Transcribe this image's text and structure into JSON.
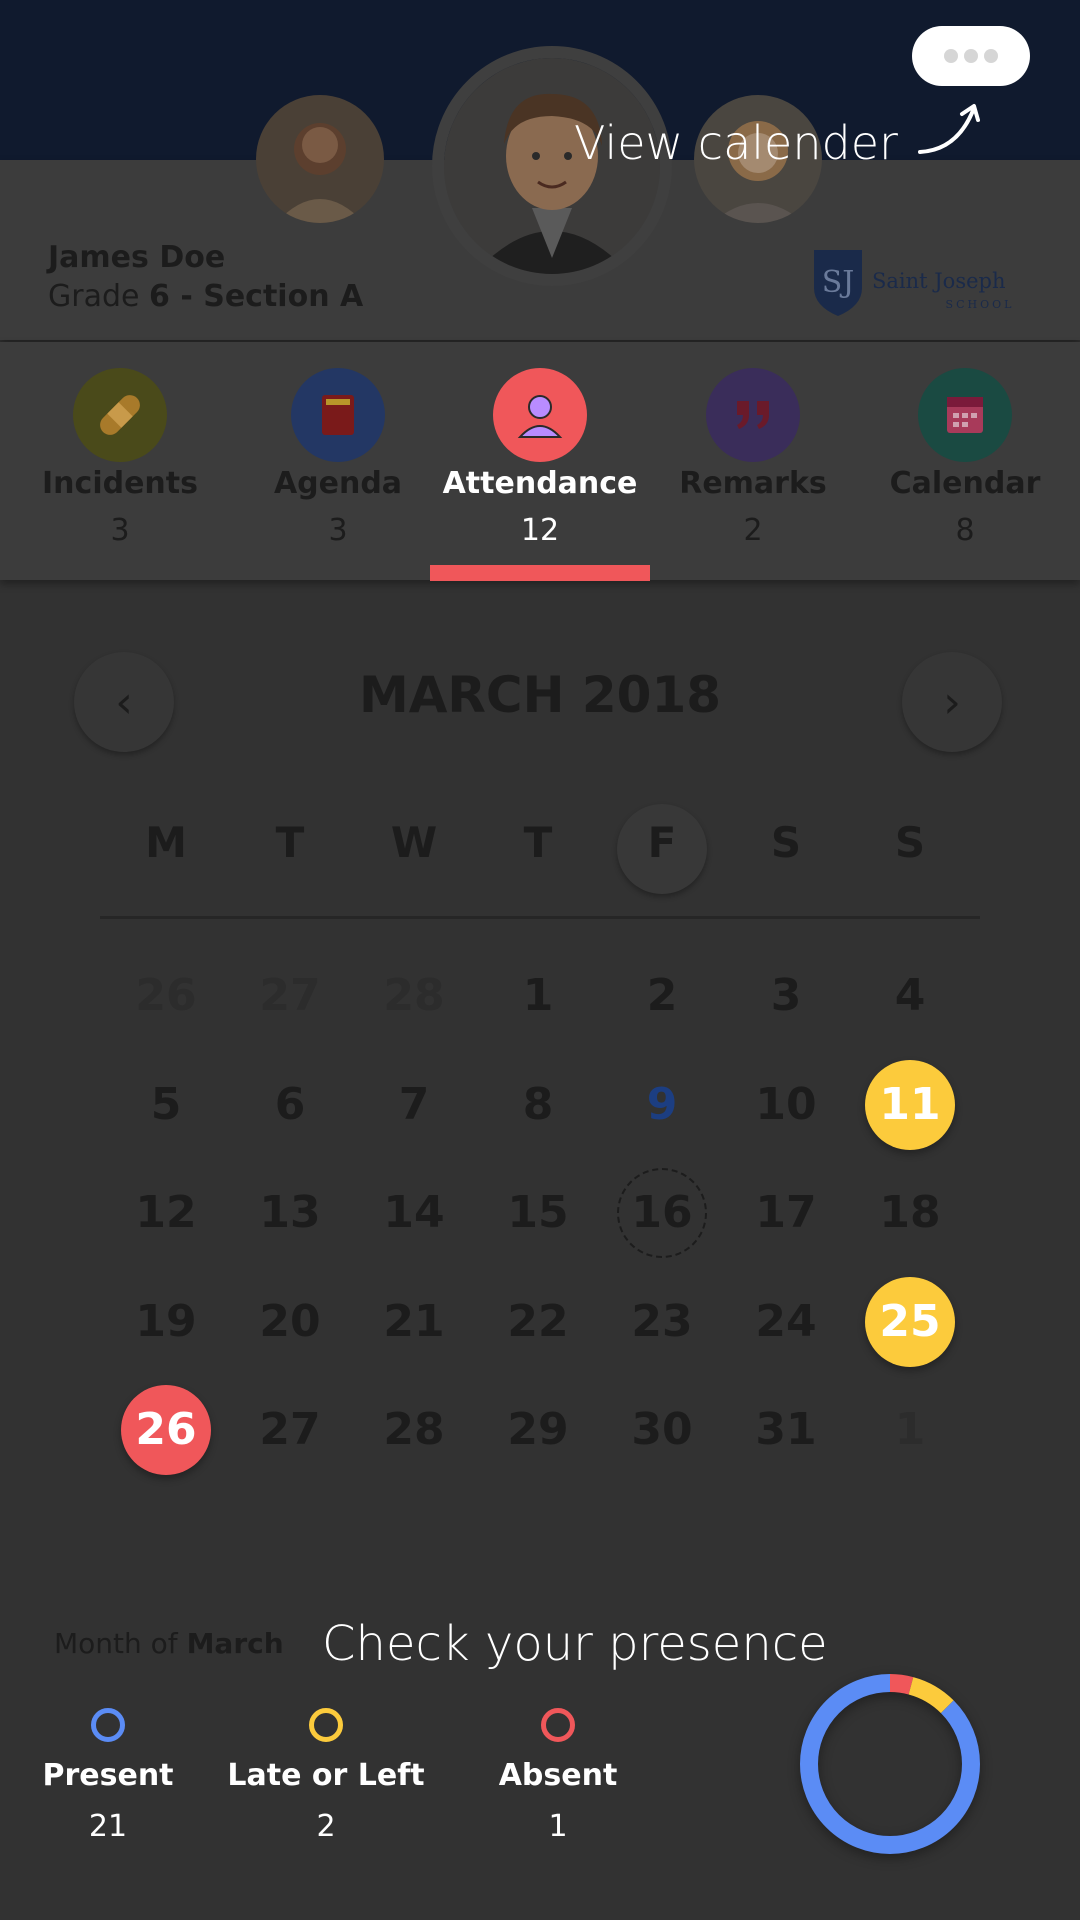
{
  "header": {
    "more_button": "more-options",
    "hint_view": "View calender"
  },
  "student": {
    "name": "James Doe",
    "grade_prefix": "Grade ",
    "grade": "6",
    "grade_sep": " - Section ",
    "section": "A"
  },
  "school": {
    "name_line1": "Saint Joseph",
    "name_line2": "SCHOOL",
    "monogram": "SJ"
  },
  "tabs": [
    {
      "label": "Incidents",
      "count": "3",
      "color": "#f1e60e",
      "icon": "bandage-icon"
    },
    {
      "label": "Agenda",
      "count": "3",
      "color": "#3a6bd9",
      "icon": "book-icon"
    },
    {
      "label": "Attendance",
      "count": "12",
      "color": "#f0575a",
      "icon": "person-icon"
    },
    {
      "label": "Remarks",
      "count": "2",
      "color": "#7e4cd8",
      "icon": "quote-icon"
    },
    {
      "label": "Calendar",
      "count": "8",
      "color": "#0f8a78",
      "icon": "calendar-icon"
    }
  ],
  "calendar": {
    "prev_label": "‹",
    "next_label": "›",
    "month_title": "MARCH 2018",
    "weekdays": [
      "M",
      "T",
      "W",
      "T",
      "F",
      "S",
      "S"
    ],
    "rows": [
      [
        "26",
        "27",
        "28",
        "1",
        "2",
        "3",
        "4"
      ],
      [
        "5",
        "6",
        "7",
        "8",
        "9",
        "10",
        "11"
      ],
      [
        "12",
        "13",
        "14",
        "15",
        "16",
        "17",
        "18"
      ],
      [
        "19",
        "20",
        "21",
        "22",
        "23",
        "24",
        "25"
      ],
      [
        "26",
        "27",
        "28",
        "29",
        "30",
        "31",
        "1"
      ]
    ]
  },
  "summary": {
    "month_of_prefix": "Month of ",
    "month_name": "March",
    "hint_check": "Check your presence",
    "legend": [
      {
        "label": "Present",
        "value": "21",
        "color": "#5b8cf5"
      },
      {
        "label": "Late or Left",
        "value": "2",
        "color": "#fccb3c"
      },
      {
        "label": "Absent",
        "value": "1",
        "color": "#f0575a"
      }
    ]
  }
}
